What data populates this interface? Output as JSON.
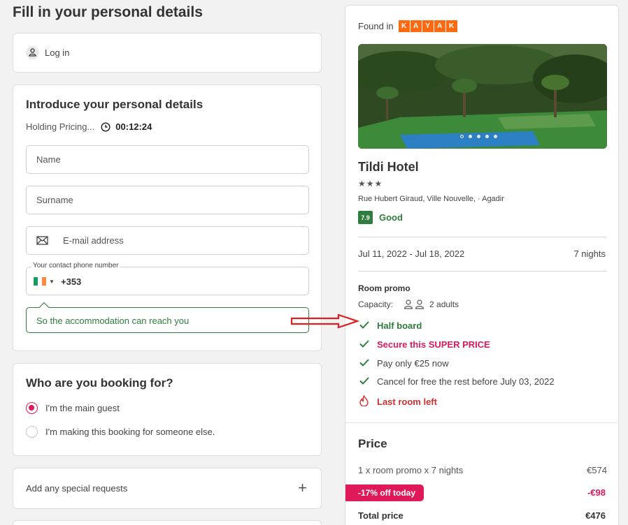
{
  "page": {
    "title": "Fill in your personal details"
  },
  "login": {
    "label": "Log in"
  },
  "details": {
    "heading": "Introduce your personal details",
    "holding_label": "Holding Pricing...",
    "timer": "00:12:24",
    "name_placeholder": "Name",
    "surname_placeholder": "Surname",
    "email_placeholder": "E-mail address",
    "phone_label": "Your contact phone number",
    "phone_code": "+353",
    "tooltip": "So the accommodation can reach you"
  },
  "booking_for": {
    "heading": "Who are you booking for?",
    "options": [
      "I'm the main guest",
      "I'm making this booking for someone else."
    ],
    "selected_index": 0
  },
  "special": {
    "label": "Add any special requests"
  },
  "summary": {
    "found_in": "Found in",
    "brand_letters": [
      "K",
      "A",
      "Y",
      "A",
      "K"
    ],
    "hotel_name": "Tildi Hotel",
    "stars": "★★★",
    "address": "Rue Hubert Giraud, Ville Nouvelle, · Agadir",
    "rating_score": "7.9",
    "rating_word": "Good",
    "dates": "Jul 11, 2022 - Jul 18, 2022",
    "nights": "7 nights",
    "room_type": "Room promo",
    "capacity_label": "Capacity:",
    "capacity_value": "2 adults",
    "features": [
      {
        "text": "Half board",
        "style": "green",
        "icon": "check-icon"
      },
      {
        "text": "Secure this SUPER PRICE",
        "style": "pink",
        "icon": "check-icon"
      },
      {
        "text": "Pay only €25 now",
        "style": "normal",
        "icon": "check-icon"
      },
      {
        "text": "Cancel for free the rest before July 03, 2022",
        "style": "normal",
        "icon": "check-icon"
      },
      {
        "text": "Last room left",
        "style": "red",
        "icon": "flame-icon"
      }
    ],
    "price_title": "Price",
    "line_item": "1 x room promo x 7 nights",
    "line_item_value": "€574",
    "discount_label": "-17% off today",
    "discount_value": "-€98",
    "total_label": "Total price",
    "total_value": "€476"
  },
  "colors": {
    "accent": "#e0195a",
    "success": "#2e7d3c",
    "kayak": "#ff690f",
    "annotation_arrow": "#e02020"
  }
}
